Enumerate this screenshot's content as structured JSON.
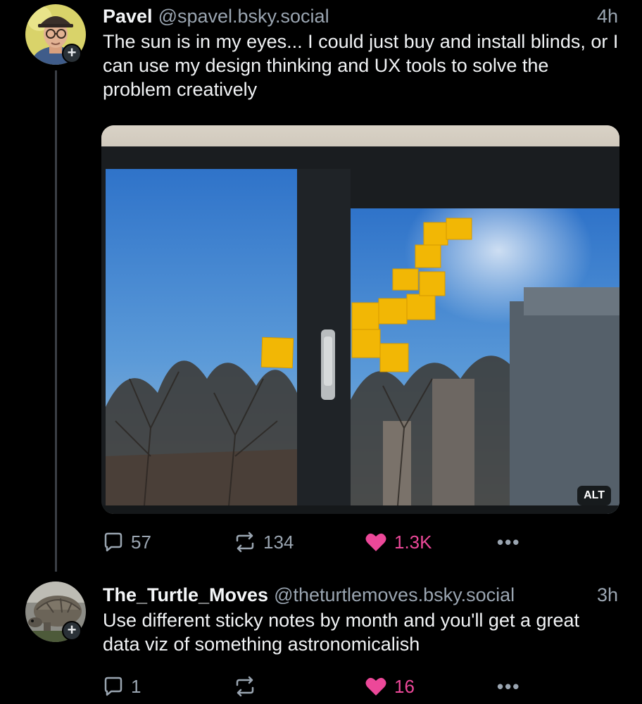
{
  "post1": {
    "author": "Pavel",
    "handle": "@spavel.bsky.social",
    "time": "4h",
    "text": "The sun is in my eyes... I could just buy and install blinds, or I can use my design thinking and UX tools to solve the problem creatively",
    "image_alt_badge": "ALT",
    "replies": "57",
    "reposts": "134",
    "likes": "1.3K"
  },
  "post2": {
    "author": "The_Turtle_Moves",
    "handle": "@theturtlemoves.bsky.social",
    "time": "3h",
    "text": "Use different sticky notes by month and you'll get a great data viz of something astronomicalish",
    "replies": "1",
    "reposts": "",
    "likes": "16"
  },
  "icons": {
    "follow": "+",
    "more": "•••"
  },
  "colors": {
    "background": "#000000",
    "like": "#ec4899",
    "muted": "#9aa5b1",
    "sticky_note": "#f2b705"
  }
}
